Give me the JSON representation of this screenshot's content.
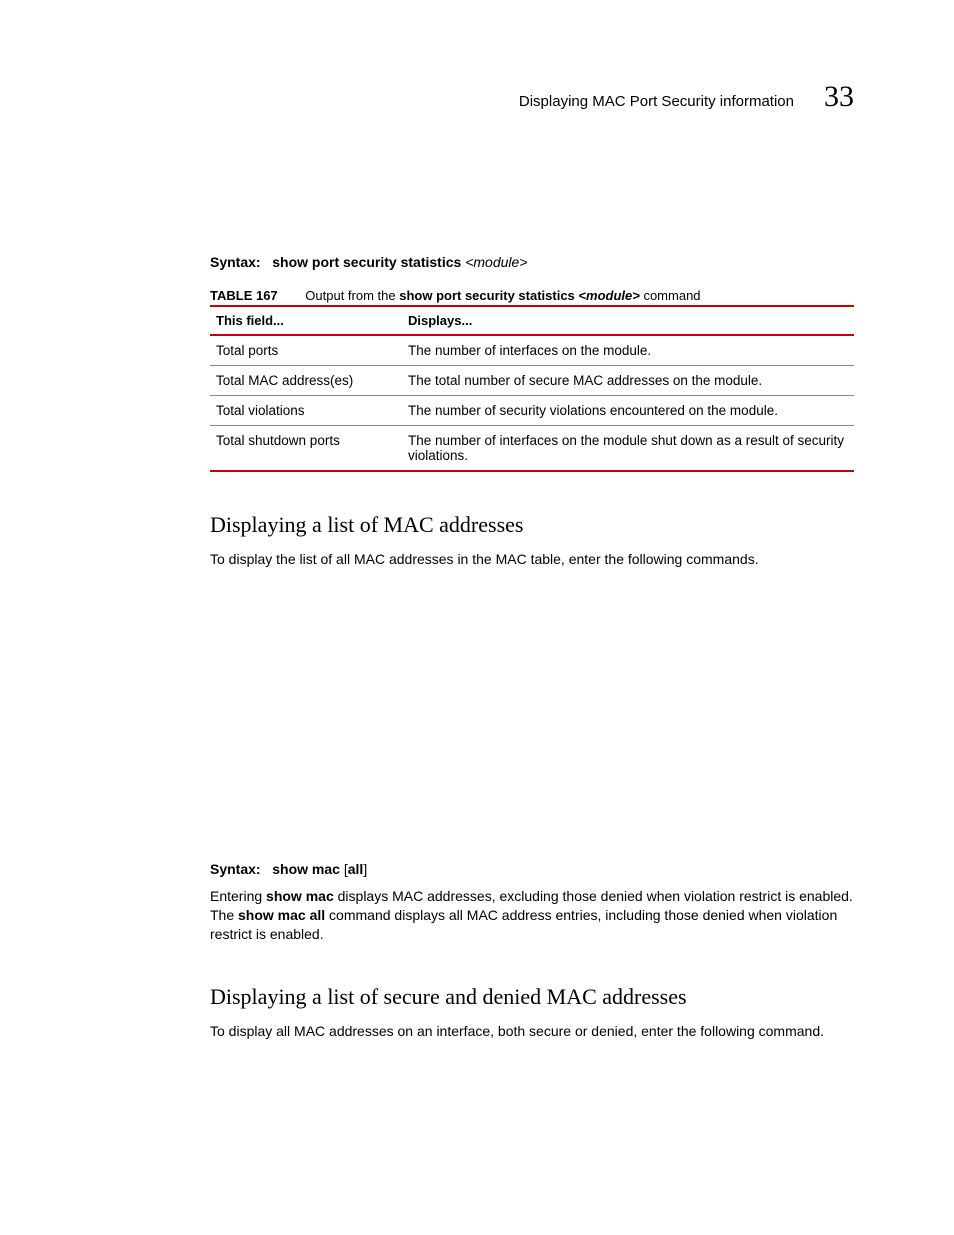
{
  "header": {
    "title": "Displaying MAC Port Security information",
    "chapter": "33"
  },
  "syntax1": {
    "label": "Syntax:",
    "cmd": "show port security statistics",
    "arg": "<module>"
  },
  "table167": {
    "label": "TABLE 167",
    "caption_pre": "Output from the ",
    "caption_cmd": "show port security statistics",
    "caption_arg": "<module>",
    "caption_post": " command",
    "head1": "This field...",
    "head2": "Displays...",
    "rows": [
      {
        "f": "Total ports",
        "d": "The number of interfaces on the module."
      },
      {
        "f": "Total MAC address(es)",
        "d": "The total number of secure MAC addresses on the module."
      },
      {
        "f": "Total violations",
        "d": "The number of security violations encountered on the module."
      },
      {
        "f": "Total shutdown ports",
        "d": "The number of interfaces on the module shut down as a result of security violations."
      }
    ]
  },
  "section1": {
    "title": "Displaying a list of MAC addresses",
    "body": "To display the list of all MAC addresses in the MAC table, enter the following commands."
  },
  "syntax2": {
    "label": "Syntax:",
    "cmd_pre": "show mac ",
    "bracket_open": "[",
    "cmd_opt": "all",
    "bracket_close": "]"
  },
  "para2": {
    "t1": "Entering ",
    "b1": "show mac",
    "t2": " displays MAC addresses, excluding those denied when violation restrict is enabled. The ",
    "b2": "show mac all",
    "t3": " command displays all MAC address entries, including those denied when violation restrict is enabled."
  },
  "section2": {
    "title": "Displaying a list of secure and denied MAC addresses",
    "body": "To display all MAC addresses on an interface, both secure or denied, enter the following command."
  }
}
